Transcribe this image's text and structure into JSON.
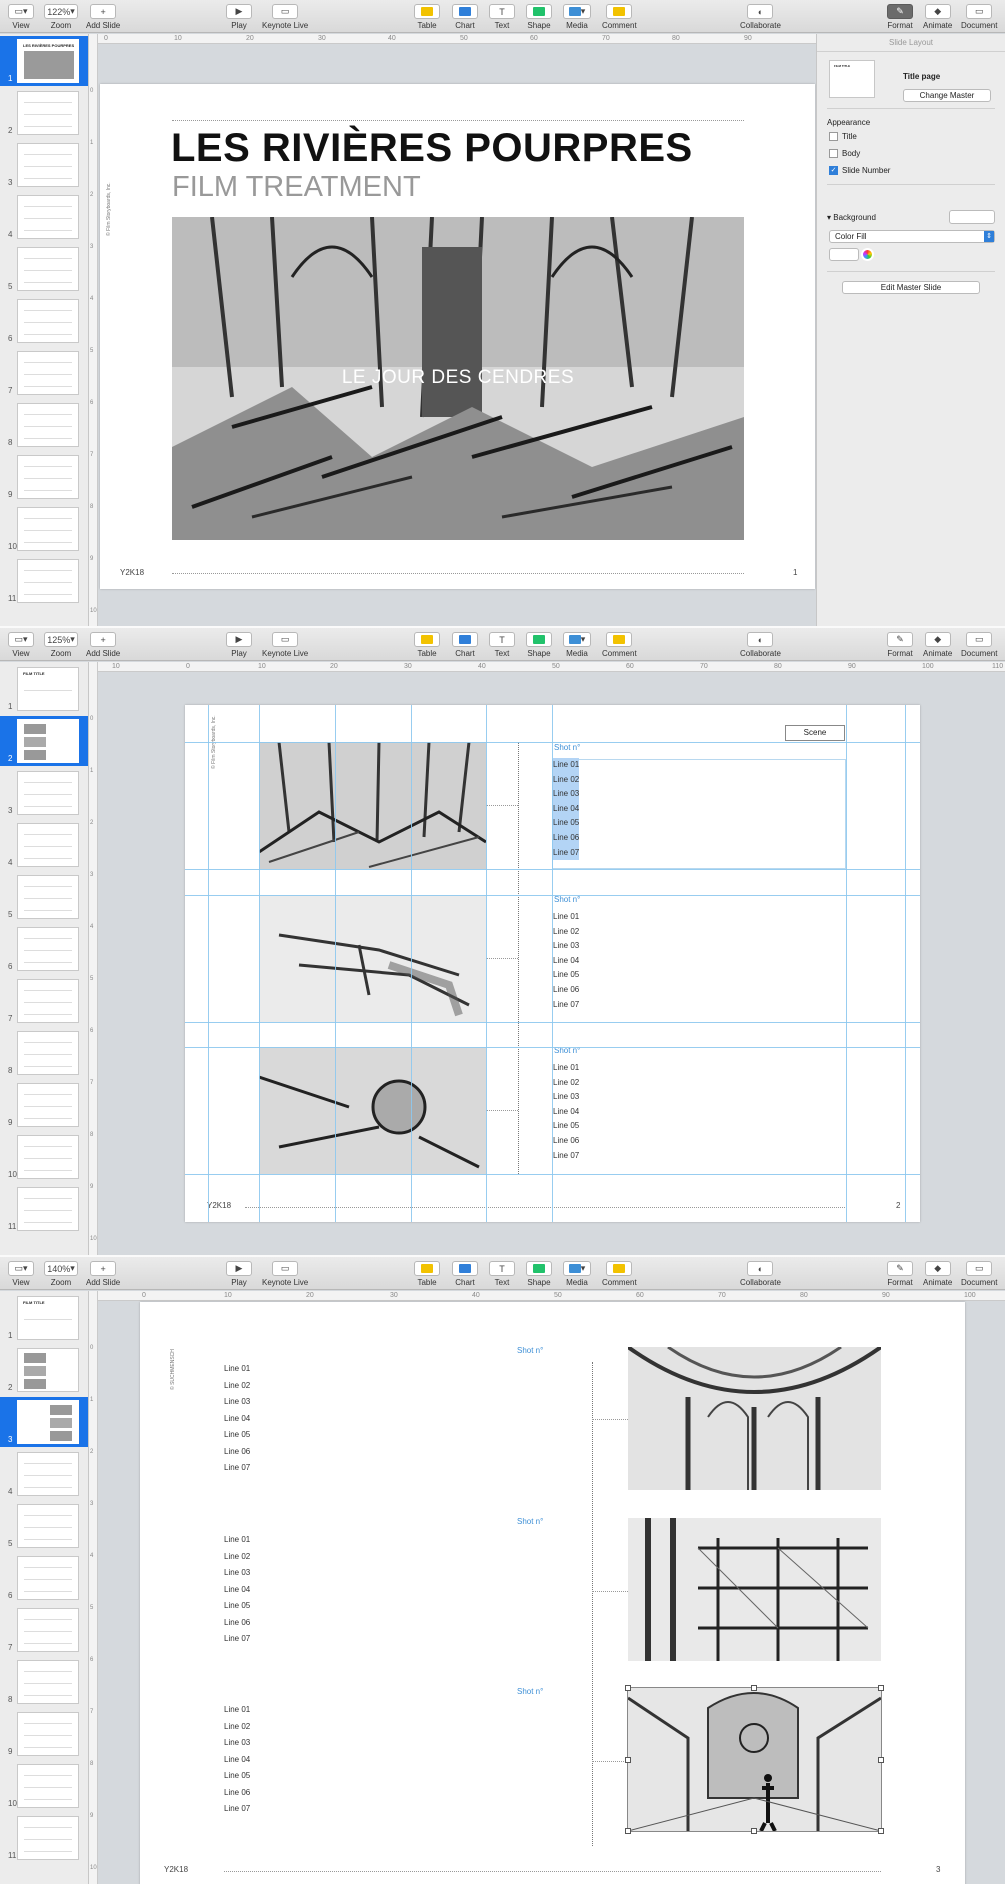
{
  "toolbar": {
    "view": "View",
    "zoom": "Zoom",
    "add_slide": "Add Slide",
    "play": "Play",
    "keynote_live": "Keynote Live",
    "table": "Table",
    "chart": "Chart",
    "text": "Text",
    "shape": "Shape",
    "media": "Media",
    "comment": "Comment",
    "collaborate": "Collaborate",
    "format": "Format",
    "animate": "Animate",
    "document": "Document",
    "accent_table": "#f2c200",
    "accent_chart": "#2f7fd9",
    "accent_shape": "#21c26b",
    "accent_media": "#3d8fd6",
    "accent_comment": "#f2c200"
  },
  "windows": [
    {
      "zoom": "122%",
      "selected_slide": 1
    },
    {
      "zoom": "125%",
      "selected_slide": 2
    },
    {
      "zoom": "140%",
      "selected_slide": 3
    }
  ],
  "slide_numbers": [
    "1",
    "2",
    "3",
    "4",
    "5",
    "6",
    "7",
    "8",
    "9",
    "10",
    "11"
  ],
  "thumb_titles": {
    "t1": "LES RIVIÈRES POURPRES",
    "film_title": "FILM TITLE"
  },
  "ruler_top": [
    "0",
    "10",
    "20",
    "30",
    "40",
    "50",
    "60",
    "70",
    "80",
    "90"
  ],
  "ruler_top_w2": [
    "10",
    "0",
    "10",
    "20",
    "30",
    "40",
    "50",
    "60",
    "70",
    "80",
    "90",
    "100",
    "110"
  ],
  "ruler_top_w3": [
    "0",
    "10",
    "20",
    "30",
    "40",
    "50",
    "60",
    "70",
    "80",
    "90",
    "100"
  ],
  "ruler_left": [
    "0",
    "1",
    "2",
    "3",
    "4",
    "5",
    "6",
    "7",
    "8",
    "9",
    "10"
  ],
  "slide1": {
    "title": "LES RIVIÈRES POURPRES",
    "subtitle": "FILM TREATMENT",
    "caption": "LE JOUR DES CENDRES",
    "copyright": "© Film Storyboards, Inc.",
    "footer": "Y2K18",
    "page_number": "1"
  },
  "inspector": {
    "header": "Slide Layout",
    "master_name": "Title page",
    "thumb_label": "FILM TITLE",
    "change_master": "Change Master",
    "appearance": "Appearance",
    "title_cb": "Title",
    "body_cb": "Body",
    "slide_number_cb": "Slide Number",
    "background": "Background",
    "fill_type": "Color Fill",
    "edit_master": "Edit Master Slide",
    "title_checked": false,
    "body_checked": false,
    "slide_number_checked": true
  },
  "slide2": {
    "copyright": "© Film Storyboards, Inc.",
    "scene_label": "Scene",
    "shots": [
      {
        "label": "Shot n°",
        "lines": [
          "Line 01",
          "Line 02",
          "Line 03",
          "Line 04",
          "Line 05",
          "Line 06",
          "Line 07"
        ],
        "selected": true
      },
      {
        "label": "Shot n°",
        "lines": [
          "Line 01",
          "Line 02",
          "Line 03",
          "Line 04",
          "Line 05",
          "Line 06",
          "Line 07"
        ]
      },
      {
        "label": "Shot n°",
        "lines": [
          "Line 01",
          "Line 02",
          "Line 03",
          "Line 04",
          "Line 05",
          "Line 06",
          "Line 07"
        ]
      }
    ],
    "footer": "Y2K18",
    "page_number": "2"
  },
  "slide3": {
    "copyright": "© SUCHMENSCH",
    "shots": [
      {
        "label": "Shot n°",
        "lines": [
          "Line 01",
          "Line 02",
          "Line 03",
          "Line 04",
          "Line 05",
          "Line 06",
          "Line 07"
        ]
      },
      {
        "label": "Shot n°",
        "lines": [
          "Line 01",
          "Line 02",
          "Line 03",
          "Line 04",
          "Line 05",
          "Line 06",
          "Line 07"
        ]
      },
      {
        "label": "Shot n°",
        "lines": [
          "Line 01",
          "Line 02",
          "Line 03",
          "Line 04",
          "Line 05",
          "Line 06",
          "Line 07"
        ]
      }
    ],
    "footer": "Y2K18",
    "page_number": "3"
  }
}
